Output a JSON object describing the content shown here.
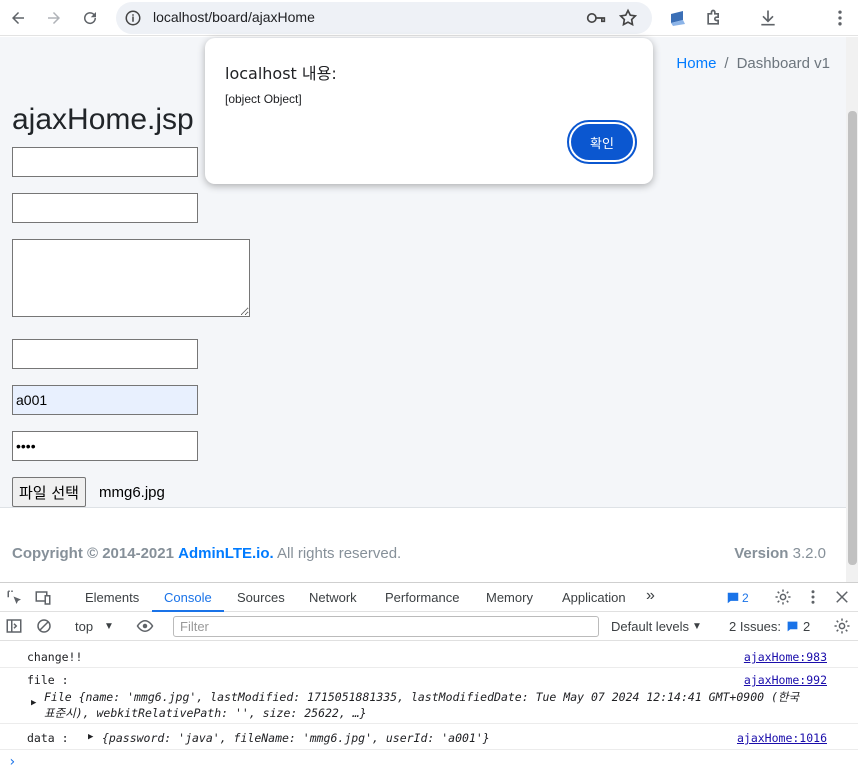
{
  "browser": {
    "url": "localhost/board/ajaxHome"
  },
  "page": {
    "breadcrumb": {
      "home": "Home",
      "separator": "/",
      "current": "Dashboard v1"
    },
    "title": "ajaxHome.jsp",
    "fields": {
      "field1": "",
      "field2": "",
      "field4": "",
      "user_id": "a001",
      "password": "java"
    },
    "file_button": "파일 선택",
    "file_name": "mmg6.jpg",
    "footer": {
      "copyright_prefix": "Copyright © 2014-2021",
      "brand": "AdminLTE.io.",
      "suffix": "All rights reserved.",
      "version_label": "Version",
      "version": "3.2.0"
    }
  },
  "dialog": {
    "title": "localhost 내용:",
    "message": "[object Object]",
    "ok": "확인"
  },
  "devtools": {
    "tabs": [
      "Elements",
      "Console",
      "Sources",
      "Network",
      "Performance",
      "Memory",
      "Application"
    ],
    "active_tab": "Console",
    "message_count": "2",
    "context": "top",
    "filter_placeholder": "Filter",
    "levels": "Default levels",
    "issues_label": "2 Issues:",
    "issues_count": "2",
    "logs": [
      {
        "text": "change!!",
        "source": "ajaxHome:983"
      },
      {
        "text": "file :",
        "source": "ajaxHome:992",
        "object_line1": "File {name: 'mmg6.jpg', lastModified: 1715051881335, lastModifiedDate: Tue May 07 2024 12:14:41 GMT+0900 (한국",
        "object_line2": "표준시), webkitRelativePath: '', size: 25622, …}"
      },
      {
        "text": "data :",
        "source": "ajaxHome:1016",
        "object": "{password: 'java', fileName: 'mmg6.jpg', userId: 'a001'}"
      }
    ]
  }
}
